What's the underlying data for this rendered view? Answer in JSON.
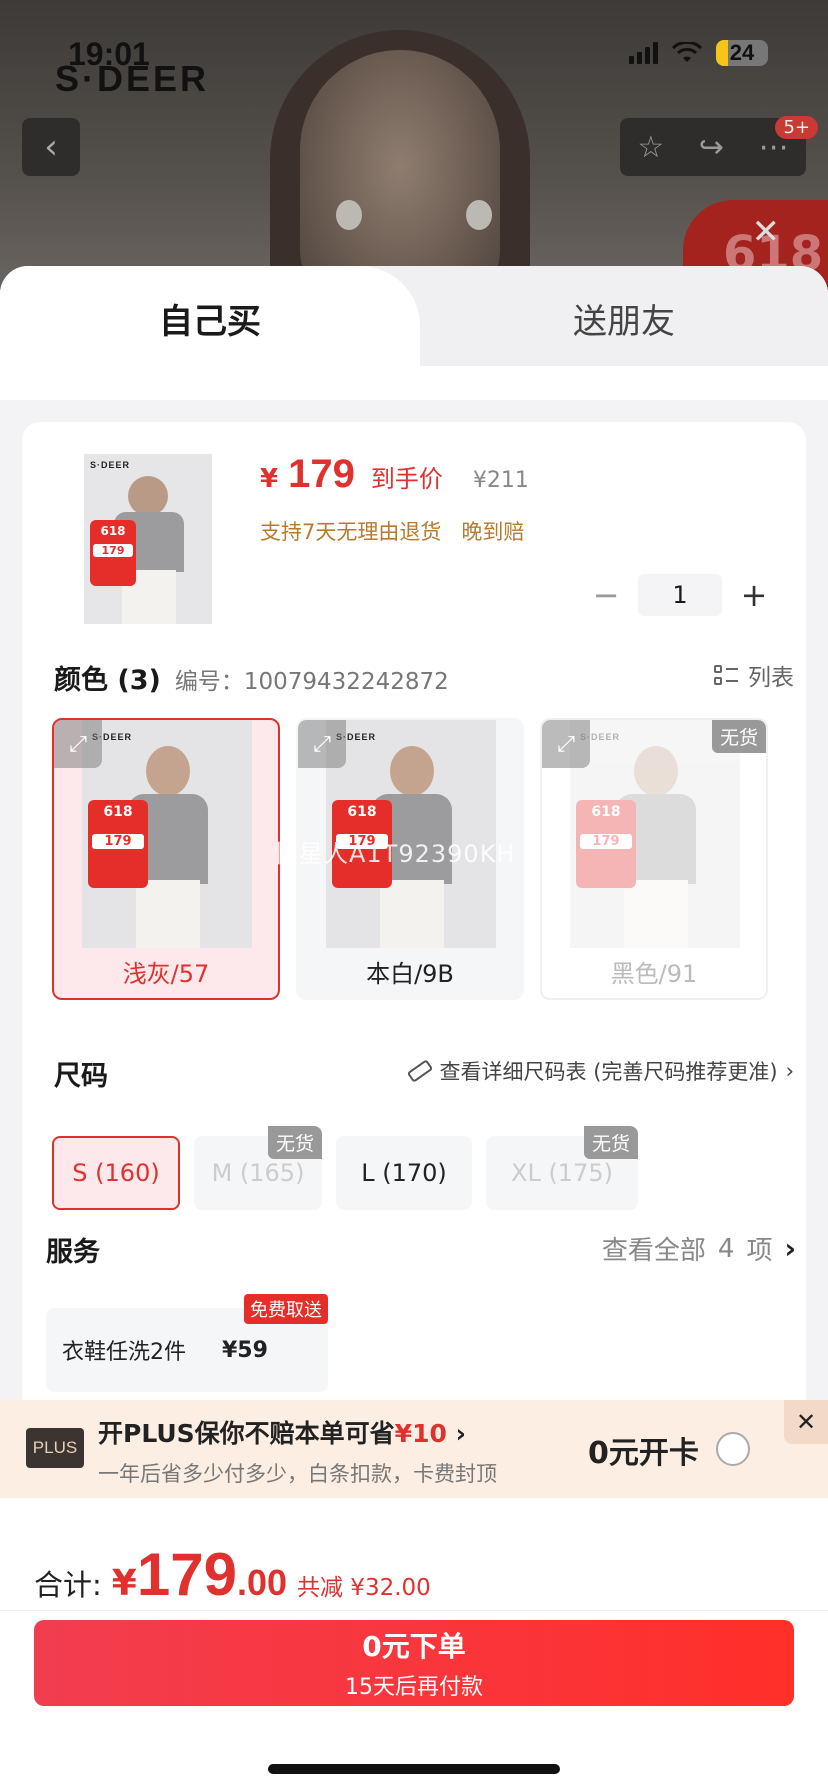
{
  "status_bar": {
    "time": "19:01",
    "battery": "24"
  },
  "brand": "S·DEER",
  "header": {
    "notif_count": "5+",
    "promo_tag": "618"
  },
  "tabs": [
    {
      "label": "自己买"
    },
    {
      "label": "送朋友"
    }
  ],
  "product": {
    "price_symbol": "¥",
    "price": "179",
    "price_label": "到手价",
    "original_price": "¥211",
    "services": [
      "支持7天无理由退货",
      "晚到赔"
    ],
    "quantity": "1",
    "thumb_tag_price": "179"
  },
  "color_section": {
    "title": "颜色 (3)",
    "sku_label": "编号：10079432242872",
    "list_toggle": "列表",
    "options": [
      {
        "label": "浅灰/57",
        "state": "selected",
        "sold_out": ""
      },
      {
        "label": "本白/9B",
        "state": "normal",
        "sold_out": ""
      },
      {
        "label": "黑色/91",
        "state": "disabled",
        "sold_out": "无货"
      }
    ],
    "promo_tag": "618",
    "promo_price": "179",
    "watermark": "慢星人A1T92390KH"
  },
  "size_section": {
    "title": "尺码",
    "guide": "查看详细尺码表 (完善尺码推荐更准)",
    "options": [
      {
        "label": "S (160)",
        "state": "selected",
        "sold_out": ""
      },
      {
        "label": "M (165)",
        "state": "disabled",
        "sold_out": "无货"
      },
      {
        "label": "L (170)",
        "state": "normal",
        "sold_out": ""
      },
      {
        "label": "XL (175)",
        "state": "disabled",
        "sold_out": "无货"
      }
    ]
  },
  "service_section": {
    "title": "服务",
    "more_prefix": "查看全部",
    "more_count": "4",
    "more_suffix": "项",
    "item": {
      "name": "衣鞋任洗2件",
      "price": "¥59",
      "badge": "免费取送"
    }
  },
  "plus_banner": {
    "logo": "PLUS",
    "title_prefix": "开PLUS保你不赔本单可省",
    "title_amount": "¥10",
    "subtitle": "一年后省多少付多少，白条扣款，卡费封顶",
    "cta": "0元开卡"
  },
  "footer": {
    "total_label": "合计:",
    "total_symbol": "¥",
    "total_int": "179",
    "total_dec": ".00",
    "saving": "共减 ¥32.00",
    "button_main": "0元下单",
    "button_sub": "15天后再付款"
  },
  "colors": {
    "accent": "#e0312f",
    "selected_bg": "#fde8eb",
    "plus_bg": "#fdeee3"
  }
}
